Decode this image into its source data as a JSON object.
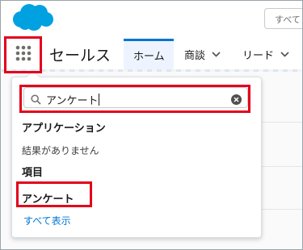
{
  "header": {
    "logo_icon": "salesforce-cloud-icon",
    "global_search_label": "すべて"
  },
  "nav": {
    "app_launcher_icon": "waffle-grid-icon",
    "app_name": "セールス",
    "tabs": [
      {
        "label": "ホーム",
        "active": true
      },
      {
        "label": "商談",
        "active": false
      },
      {
        "label": "リード",
        "active": false
      }
    ]
  },
  "launcher": {
    "search_value": "アンケート",
    "sections": {
      "apps_heading": "アプリケーション",
      "apps_empty": "結果がありません",
      "items_heading": "項目",
      "item_result": "アンケート",
      "show_all": "すべて表示"
    }
  },
  "colors": {
    "brand": "#00a1e0",
    "accent": "#0176d3",
    "highlight": "#e3001b"
  }
}
